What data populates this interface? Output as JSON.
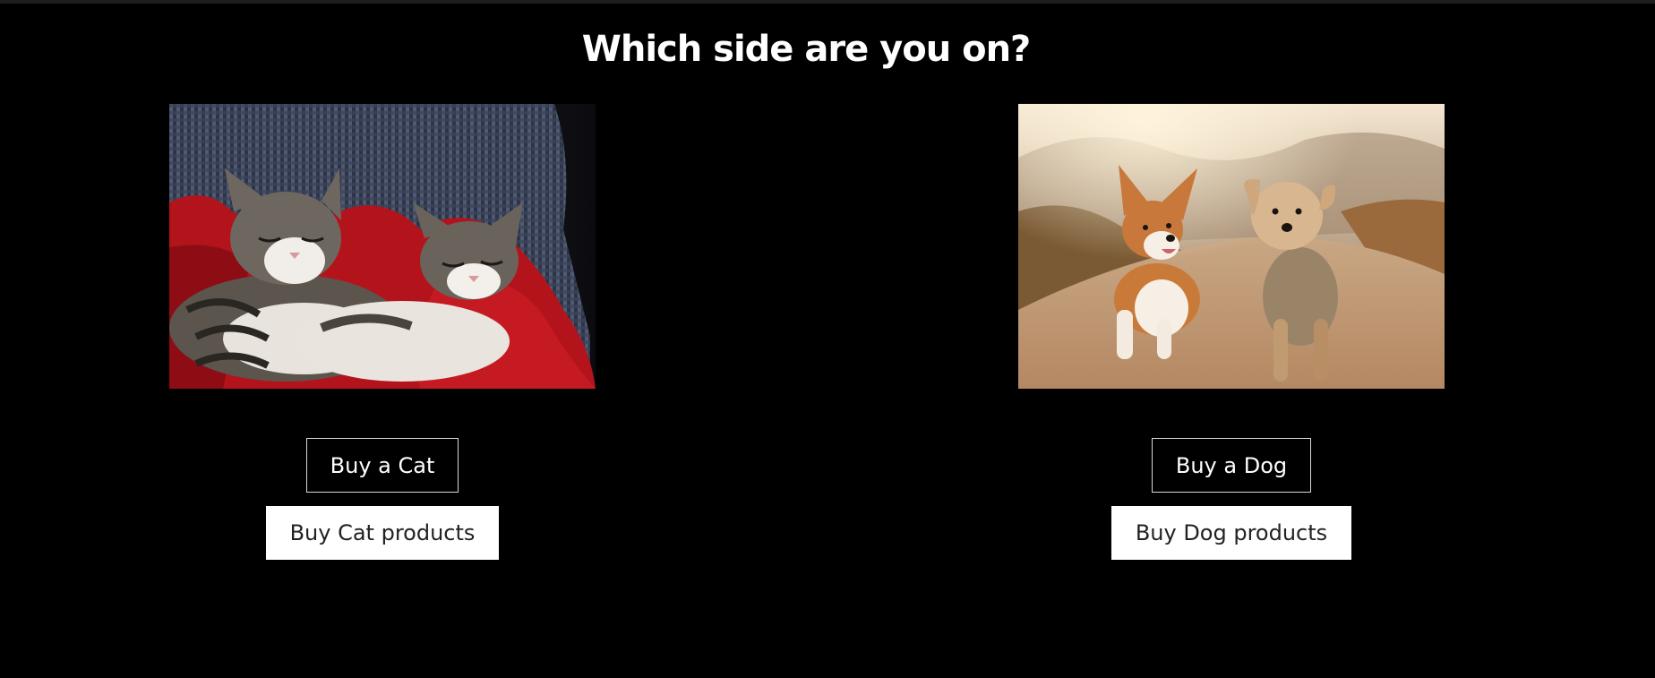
{
  "page": {
    "title": "Which side are you on?"
  },
  "cat_section": {
    "image_alt": "Two kittens sleeping on a red blanket",
    "buy_button": "Buy a Cat",
    "products_button": "Buy Cat products"
  },
  "dog_section": {
    "image_alt": "Corgi and terrier running on a dirt road",
    "buy_button": "Buy a Dog",
    "products_button": "Buy Dog products"
  },
  "colors": {
    "background": "#000000",
    "text": "#ffffff",
    "solid_button_bg": "#ffffff",
    "solid_button_text": "#222222"
  }
}
